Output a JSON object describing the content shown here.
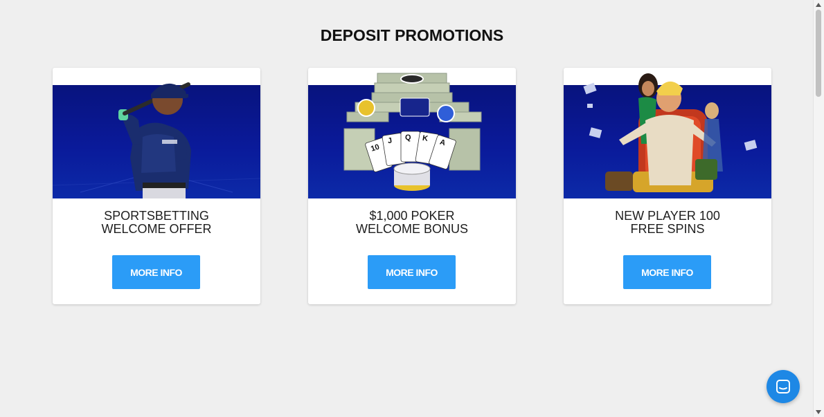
{
  "section": {
    "title": "DEPOSIT PROMOTIONS"
  },
  "promotions": [
    {
      "title_line1": "SPORTSBETTING",
      "title_line2": "WELCOME OFFER",
      "button_label": "MORE INFO",
      "image_icon": "baseball-player-image"
    },
    {
      "title_line1": "$1,000 POKER",
      "title_line2": "WELCOME BONUS",
      "button_label": "MORE INFO",
      "image_icon": "poker-cards-cash-image"
    },
    {
      "title_line1": "NEW PLAYER 100",
      "title_line2": "FREE SPINS",
      "button_label": "MORE INFO",
      "image_icon": "casino-characters-image"
    }
  ],
  "chat": {
    "icon": "chat-bubble-icon"
  },
  "colors": {
    "accent": "#2b9cf7",
    "banner": "#0a1a9a",
    "chat": "#1e88e5"
  }
}
